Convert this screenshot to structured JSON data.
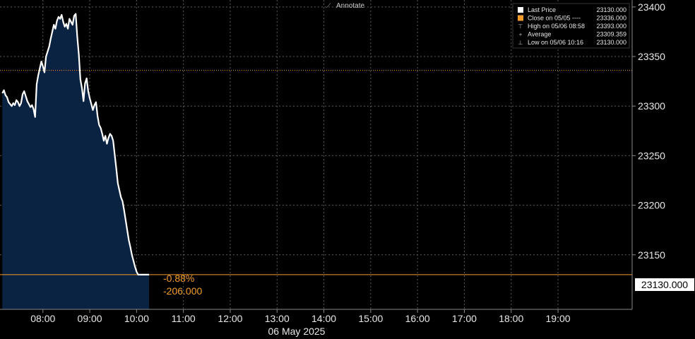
{
  "toolbar": {
    "annotate_label": "Annotate",
    "annotate_icon": "pencil-icon"
  },
  "legend": {
    "items": [
      {
        "label": "Last Price",
        "value": "23130.000",
        "swatch": "#ffffff",
        "kind": "square"
      },
      {
        "label": "Close on 05/05 ----",
        "value": "23336.000",
        "swatch": "#f39c2b",
        "kind": "square"
      },
      {
        "label": "High on 05/06 08:58",
        "value": "23393.000",
        "swatch": "#bbbbbb",
        "kind": "high-marker"
      },
      {
        "label": "Average",
        "value": "23309.359",
        "swatch": "#bbbbbb",
        "kind": "average-marker"
      },
      {
        "label": "Low on 05/06 10:16",
        "value": "23130.000",
        "swatch": "#bbbbbb",
        "kind": "low-marker"
      }
    ]
  },
  "annotations": {
    "pct_change": "-0.88%",
    "abs_change": "-206.000",
    "last_price_label": "23130.000",
    "date_label": "06 May 2025"
  },
  "colors": {
    "line": "#ffffff",
    "area": "#0b2342",
    "prev_close": "#f39c2b",
    "grid": "#5a5a5a",
    "background": "#000000"
  },
  "chart_data": {
    "type": "area",
    "title": "",
    "xlabel": "",
    "ylabel": "",
    "x_ticks": [
      "08:00",
      "09:00",
      "10:00",
      "11:00",
      "12:00",
      "13:00",
      "14:00",
      "15:00",
      "16:00",
      "17:00",
      "18:00",
      "19:00"
    ],
    "y_ticks": [
      23150,
      23200,
      23250,
      23300,
      23350,
      23400
    ],
    "ylim": [
      23095,
      23407
    ],
    "xlim": [
      "07:05",
      "20:35"
    ],
    "grid": true,
    "prev_close": 23336,
    "last_price": 23130,
    "high": 23393,
    "average": 23309.359,
    "low": 23130,
    "series": [
      {
        "name": "Last Price",
        "x": [
          "07:08",
          "07:10",
          "07:12",
          "07:14",
          "07:16",
          "07:18",
          "07:20",
          "07:22",
          "07:24",
          "07:26",
          "07:28",
          "07:30",
          "07:32",
          "07:34",
          "07:36",
          "07:38",
          "07:40",
          "07:42",
          "07:44",
          "07:46",
          "07:48",
          "07:50",
          "07:52",
          "07:54",
          "07:56",
          "07:58",
          "08:00",
          "08:02",
          "08:04",
          "08:06",
          "08:08",
          "08:10",
          "08:12",
          "08:14",
          "08:16",
          "08:18",
          "08:20",
          "08:22",
          "08:24",
          "08:26",
          "08:28",
          "08:30",
          "08:32",
          "08:34",
          "08:36",
          "08:38",
          "08:40",
          "08:42",
          "08:44",
          "08:46",
          "08:48",
          "08:50",
          "08:52",
          "08:54",
          "08:56",
          "08:58",
          "09:00",
          "09:02",
          "09:04",
          "09:06",
          "09:08",
          "09:10",
          "09:12",
          "09:14",
          "09:16",
          "09:18",
          "09:20",
          "09:22",
          "09:24",
          "09:26",
          "09:28",
          "09:30",
          "09:32",
          "09:34",
          "09:36",
          "09:38",
          "09:40",
          "09:42",
          "09:44",
          "09:46",
          "09:48",
          "09:50",
          "09:52",
          "09:54",
          "09:56",
          "09:58",
          "10:00",
          "10:02",
          "10:04",
          "10:06",
          "10:08",
          "10:10",
          "10:12",
          "10:14",
          "10:16"
        ],
        "values": [
          23313,
          23316,
          23311,
          23309,
          23304,
          23302,
          23300,
          23303,
          23301,
          23306,
          23304,
          23300,
          23303,
          23312,
          23315,
          23310,
          23305,
          23302,
          23299,
          23301,
          23297,
          23289,
          23322,
          23331,
          23338,
          23345,
          23340,
          23334,
          23350,
          23355,
          23360,
          23368,
          23375,
          23382,
          23378,
          23386,
          23390,
          23388,
          23392,
          23385,
          23380,
          23383,
          23378,
          23388,
          23385,
          23382,
          23391,
          23393,
          23370,
          23352,
          23327,
          23318,
          23305,
          23323,
          23328,
          23315,
          23308,
          23302,
          23296,
          23301,
          23304,
          23290,
          23281,
          23278,
          23272,
          23265,
          23270,
          23262,
          23268,
          23272,
          23270,
          23265,
          23251,
          23237,
          23222,
          23215,
          23208,
          23204,
          23195,
          23185,
          23175,
          23165,
          23158,
          23150,
          23144,
          23138,
          23133,
          23130,
          23130,
          23130,
          23130,
          23130,
          23130,
          23130,
          23130
        ]
      }
    ]
  }
}
